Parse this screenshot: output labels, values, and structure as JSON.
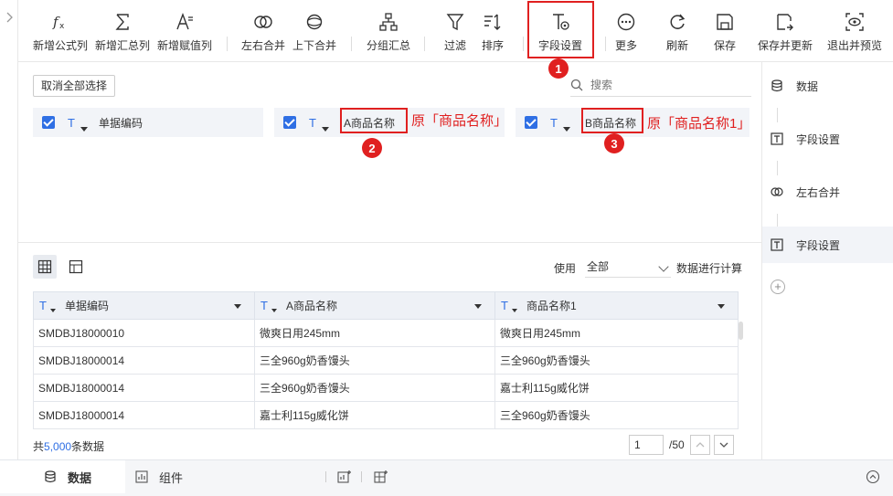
{
  "toolbar": {
    "items": [
      {
        "label": "新增公式列",
        "icon": "formula-icon"
      },
      {
        "label": "新增汇总列",
        "icon": "sigma-icon"
      },
      {
        "label": "新增赋值列",
        "icon": "assign-icon"
      },
      {
        "label": "左右合并",
        "icon": "merge-lr-icon"
      },
      {
        "label": "上下合并",
        "icon": "merge-ud-icon"
      },
      {
        "label": "分组汇总",
        "icon": "group-icon"
      },
      {
        "label": "过滤",
        "icon": "filter-icon"
      },
      {
        "label": "排序",
        "icon": "sort-icon"
      },
      {
        "label": "字段设置",
        "icon": "field-settings-icon"
      },
      {
        "label": "更多",
        "icon": "more-icon"
      },
      {
        "label": "刷新",
        "icon": "refresh-icon"
      },
      {
        "label": "保存",
        "icon": "save-icon"
      },
      {
        "label": "保存并更新",
        "icon": "save-update-icon"
      },
      {
        "label": "退出并预览",
        "icon": "exit-preview-icon"
      }
    ]
  },
  "badges": [
    "1",
    "2",
    "3"
  ],
  "config": {
    "deselect_label": "取消全部选择",
    "search_placeholder": "搜索",
    "fields": [
      {
        "name": "单据编码"
      },
      {
        "name": "A商品名称",
        "note": "原「商品名称」"
      },
      {
        "name": "B商品名称",
        "note": "原「商品名称1」"
      }
    ]
  },
  "steps": [
    {
      "label": "数据",
      "icon": "database-icon"
    },
    {
      "label": "字段设置",
      "icon": "field-settings-icon"
    },
    {
      "label": "左右合并",
      "icon": "merge-lr-icon"
    },
    {
      "label": "字段设置",
      "icon": "field-settings-icon"
    }
  ],
  "preview": {
    "use_label": "使用",
    "use_value": "全部",
    "calc_label": "数据进行计算",
    "columns": [
      "单据编码",
      "A商品名称",
      "商品名称1"
    ],
    "rows": [
      [
        "SMDBJ18000010",
        "微爽日用245mm",
        "微爽日用245mm"
      ],
      [
        "SMDBJ18000014",
        "三全960g奶香馒头",
        "三全960g奶香馒头"
      ],
      [
        "SMDBJ18000014",
        "三全960g奶香馒头",
        "嘉士利115g威化饼"
      ],
      [
        "SMDBJ18000014",
        "嘉士利115g威化饼",
        "三全960g奶香馒头"
      ]
    ],
    "total_prefix": "共",
    "total_count": "5,000",
    "total_suffix": "条数据",
    "page_value": "1",
    "page_total": "/50"
  },
  "bottom": {
    "tabs": [
      {
        "label": "数据",
        "icon": "database-icon"
      },
      {
        "label": "组件",
        "icon": "chart-icon"
      }
    ]
  },
  "colors": {
    "accent": "#2f6fe4",
    "highlight": "#e02020"
  }
}
